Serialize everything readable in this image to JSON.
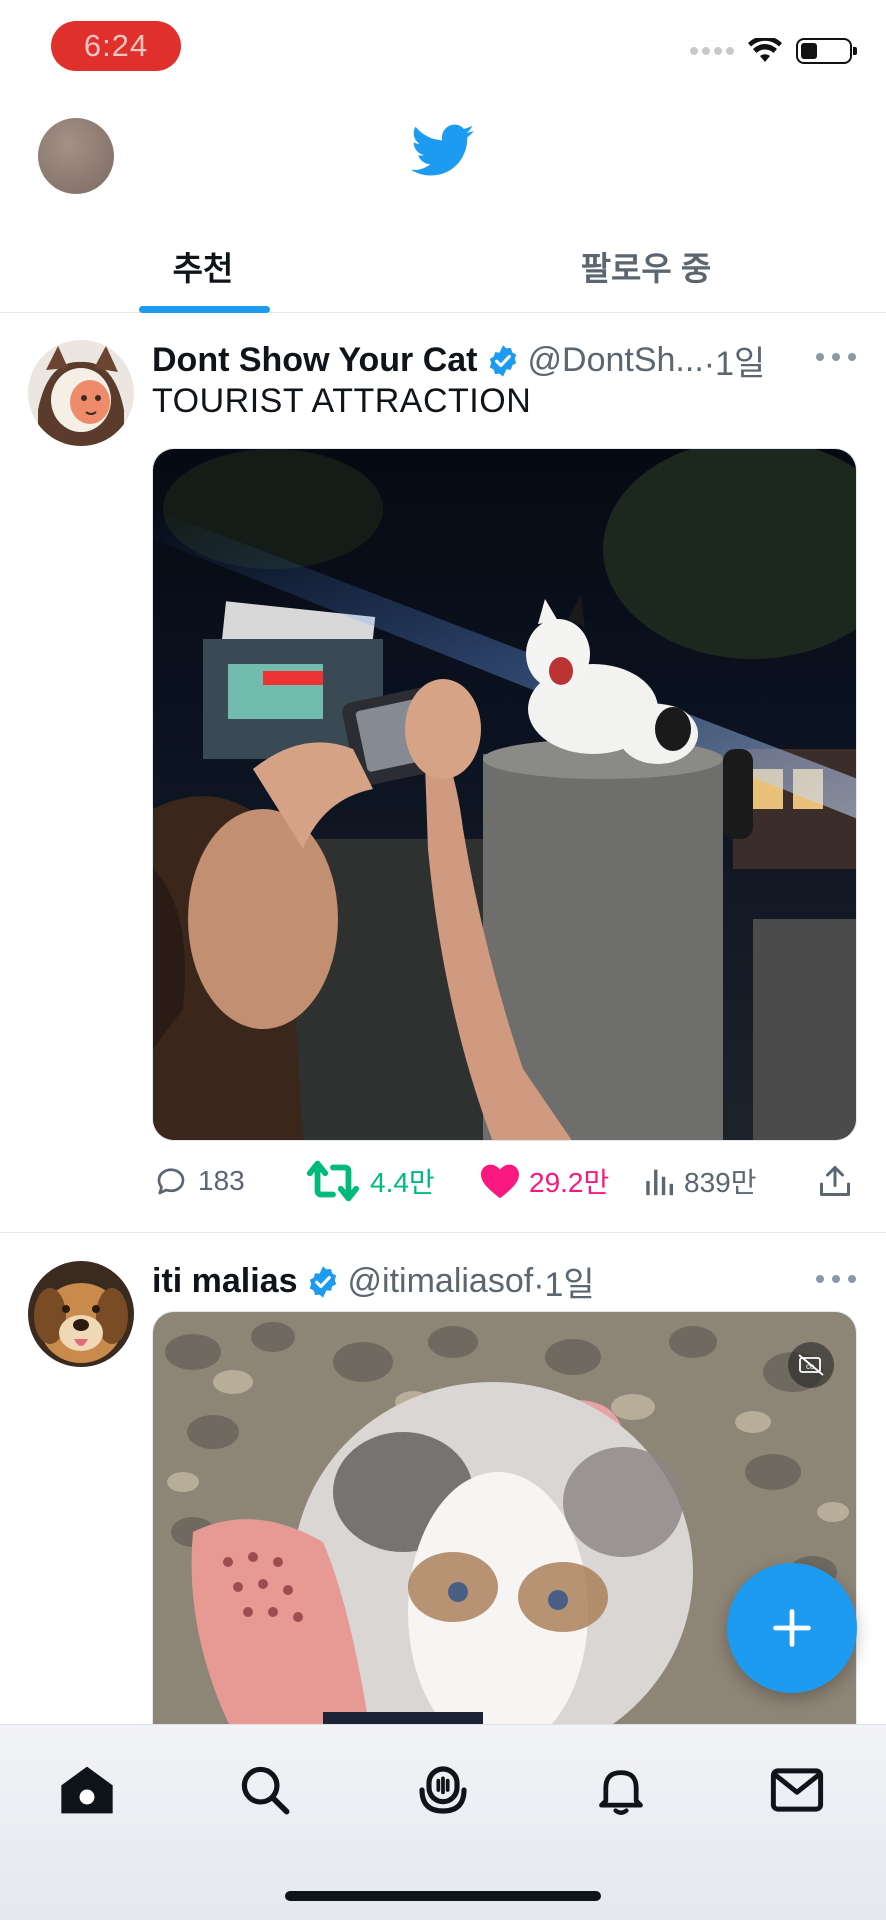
{
  "status_bar": {
    "time": "6:24"
  },
  "tabs": [
    {
      "label": "추천",
      "active": true
    },
    {
      "label": "팔로우 중",
      "active": false
    }
  ],
  "tweets": [
    {
      "display_name": "Dont Show Your Cat",
      "handle": "@DontSh...",
      "time": "·1일",
      "text": "TOURIST ATTRACTION",
      "replies": "183",
      "retweets": "4.4만",
      "likes": "29.2만",
      "views": "839만",
      "liked": true,
      "retweeted": true
    },
    {
      "display_name": "iti malias",
      "handle": "@itimaliasof",
      "time": "·1일"
    }
  ],
  "colors": {
    "accent": "#1d9bf0",
    "retweet": "#00ba7c",
    "like": "#f91880",
    "time_pill": "#e0302c"
  },
  "icons": [
    "twitter-bird-icon",
    "verified-badge-icon",
    "more-icon",
    "reply-icon",
    "retweet-icon",
    "like-icon",
    "views-icon",
    "share-icon",
    "compose-icon",
    "home-icon",
    "search-icon",
    "spaces-icon",
    "notifications-icon",
    "messages-icon",
    "captions-icon"
  ]
}
